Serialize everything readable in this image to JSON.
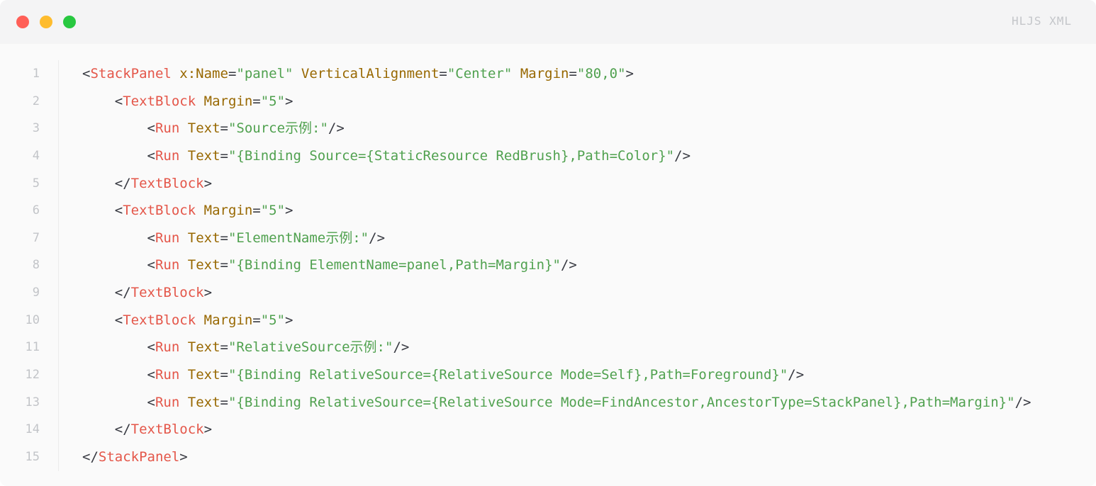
{
  "window": {
    "language_label": "HLJS XML"
  },
  "code": {
    "lines": [
      {
        "n": "1",
        "indent": "",
        "segs": [
          [
            "punc",
            "<"
          ],
          [
            "tag",
            "StackPanel"
          ],
          [
            "punc",
            " "
          ],
          [
            "attr",
            "x:Name"
          ],
          [
            "punc",
            "="
          ],
          [
            "str",
            "\"panel\""
          ],
          [
            "punc",
            " "
          ],
          [
            "attr",
            "VerticalAlignment"
          ],
          [
            "punc",
            "="
          ],
          [
            "str",
            "\"Center\""
          ],
          [
            "punc",
            " "
          ],
          [
            "attr",
            "Margin"
          ],
          [
            "punc",
            "="
          ],
          [
            "str",
            "\"80,0\""
          ],
          [
            "punc",
            ">"
          ]
        ]
      },
      {
        "n": "2",
        "indent": "    ",
        "segs": [
          [
            "punc",
            "<"
          ],
          [
            "tag",
            "TextBlock"
          ],
          [
            "punc",
            " "
          ],
          [
            "attr",
            "Margin"
          ],
          [
            "punc",
            "="
          ],
          [
            "str",
            "\"5\""
          ],
          [
            "punc",
            ">"
          ]
        ]
      },
      {
        "n": "3",
        "indent": "        ",
        "segs": [
          [
            "punc",
            "<"
          ],
          [
            "tag",
            "Run"
          ],
          [
            "punc",
            " "
          ],
          [
            "attr",
            "Text"
          ],
          [
            "punc",
            "="
          ],
          [
            "str",
            "\"Source示例:\""
          ],
          [
            "punc",
            "/>"
          ]
        ]
      },
      {
        "n": "4",
        "indent": "        ",
        "segs": [
          [
            "punc",
            "<"
          ],
          [
            "tag",
            "Run"
          ],
          [
            "punc",
            " "
          ],
          [
            "attr",
            "Text"
          ],
          [
            "punc",
            "="
          ],
          [
            "str",
            "\"{Binding Source={StaticResource RedBrush},Path=Color}\""
          ],
          [
            "punc",
            "/>"
          ]
        ]
      },
      {
        "n": "5",
        "indent": "    ",
        "segs": [
          [
            "punc",
            "</"
          ],
          [
            "tag",
            "TextBlock"
          ],
          [
            "punc",
            ">"
          ]
        ]
      },
      {
        "n": "6",
        "indent": "    ",
        "segs": [
          [
            "punc",
            "<"
          ],
          [
            "tag",
            "TextBlock"
          ],
          [
            "punc",
            " "
          ],
          [
            "attr",
            "Margin"
          ],
          [
            "punc",
            "="
          ],
          [
            "str",
            "\"5\""
          ],
          [
            "punc",
            ">"
          ]
        ]
      },
      {
        "n": "7",
        "indent": "        ",
        "segs": [
          [
            "punc",
            "<"
          ],
          [
            "tag",
            "Run"
          ],
          [
            "punc",
            " "
          ],
          [
            "attr",
            "Text"
          ],
          [
            "punc",
            "="
          ],
          [
            "str",
            "\"ElementName示例:\""
          ],
          [
            "punc",
            "/>"
          ]
        ]
      },
      {
        "n": "8",
        "indent": "        ",
        "segs": [
          [
            "punc",
            "<"
          ],
          [
            "tag",
            "Run"
          ],
          [
            "punc",
            " "
          ],
          [
            "attr",
            "Text"
          ],
          [
            "punc",
            "="
          ],
          [
            "str",
            "\"{Binding ElementName=panel,Path=Margin}\""
          ],
          [
            "punc",
            "/>"
          ]
        ]
      },
      {
        "n": "9",
        "indent": "    ",
        "segs": [
          [
            "punc",
            "</"
          ],
          [
            "tag",
            "TextBlock"
          ],
          [
            "punc",
            ">"
          ]
        ]
      },
      {
        "n": "10",
        "indent": "    ",
        "segs": [
          [
            "punc",
            "<"
          ],
          [
            "tag",
            "TextBlock"
          ],
          [
            "punc",
            " "
          ],
          [
            "attr",
            "Margin"
          ],
          [
            "punc",
            "="
          ],
          [
            "str",
            "\"5\""
          ],
          [
            "punc",
            ">"
          ]
        ]
      },
      {
        "n": "11",
        "indent": "        ",
        "segs": [
          [
            "punc",
            "<"
          ],
          [
            "tag",
            "Run"
          ],
          [
            "punc",
            " "
          ],
          [
            "attr",
            "Text"
          ],
          [
            "punc",
            "="
          ],
          [
            "str",
            "\"RelativeSource示例:\""
          ],
          [
            "punc",
            "/>"
          ]
        ]
      },
      {
        "n": "12",
        "indent": "        ",
        "segs": [
          [
            "punc",
            "<"
          ],
          [
            "tag",
            "Run"
          ],
          [
            "punc",
            " "
          ],
          [
            "attr",
            "Text"
          ],
          [
            "punc",
            "="
          ],
          [
            "str",
            "\"{Binding RelativeSource={RelativeSource Mode=Self},Path=Foreground}\""
          ],
          [
            "punc",
            "/>"
          ]
        ]
      },
      {
        "n": "13",
        "indent": "        ",
        "segs": [
          [
            "punc",
            "<"
          ],
          [
            "tag",
            "Run"
          ],
          [
            "punc",
            " "
          ],
          [
            "attr",
            "Text"
          ],
          [
            "punc",
            "="
          ],
          [
            "str",
            "\"{Binding RelativeSource={RelativeSource Mode=FindAncestor,AncestorType=StackPanel},Path=Margin}\""
          ],
          [
            "punc",
            "/>"
          ]
        ]
      },
      {
        "n": "14",
        "indent": "    ",
        "segs": [
          [
            "punc",
            "</"
          ],
          [
            "tag",
            "TextBlock"
          ],
          [
            "punc",
            ">"
          ]
        ]
      },
      {
        "n": "15",
        "indent": "",
        "segs": [
          [
            "punc",
            "</"
          ],
          [
            "tag",
            "StackPanel"
          ],
          [
            "punc",
            ">"
          ]
        ]
      }
    ]
  }
}
